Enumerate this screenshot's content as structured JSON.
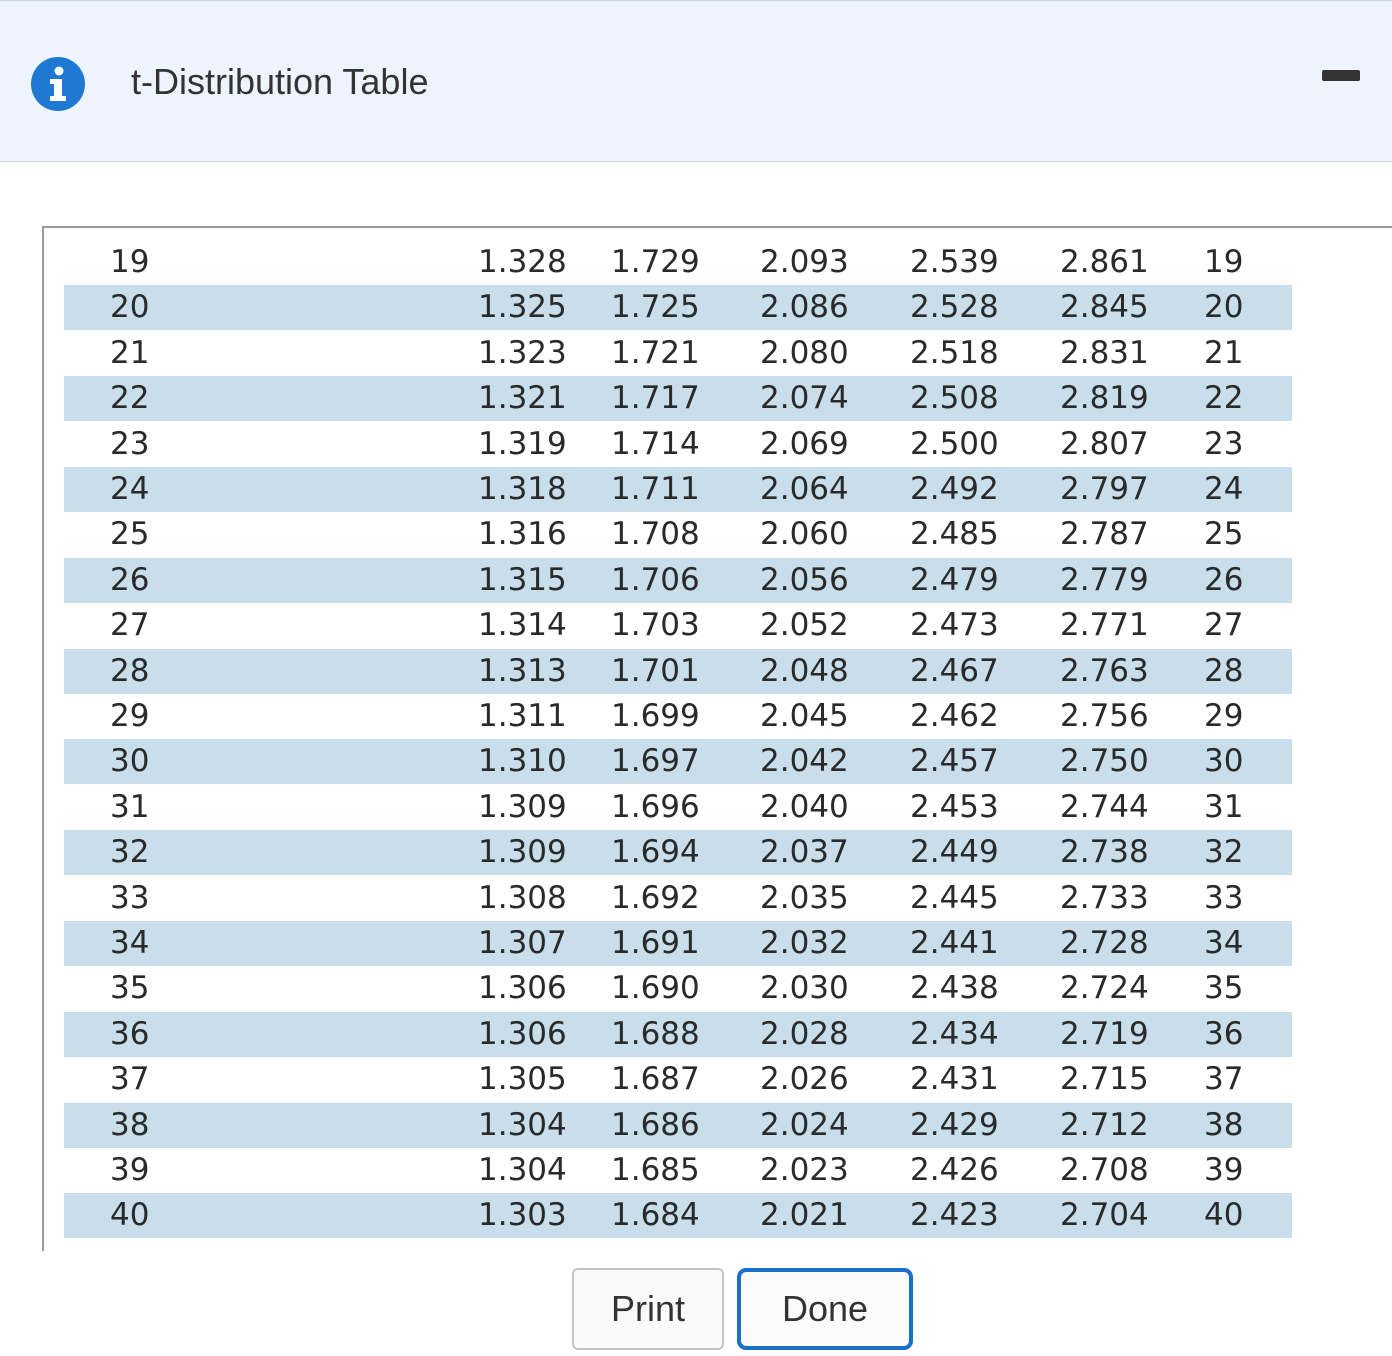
{
  "header": {
    "title": "t-Distribution Table",
    "icon": "info-icon",
    "accent_color": "#1f78d1"
  },
  "table": {
    "rows": [
      [
        "19",
        "1.328",
        "1.729",
        "2.093",
        "2.539",
        "2.861",
        "19"
      ],
      [
        "20",
        "1.325",
        "1.725",
        "2.086",
        "2.528",
        "2.845",
        "20"
      ],
      [
        "21",
        "1.323",
        "1.721",
        "2.080",
        "2.518",
        "2.831",
        "21"
      ],
      [
        "22",
        "1.321",
        "1.717",
        "2.074",
        "2.508",
        "2.819",
        "22"
      ],
      [
        "23",
        "1.319",
        "1.714",
        "2.069",
        "2.500",
        "2.807",
        "23"
      ],
      [
        "24",
        "1.318",
        "1.711",
        "2.064",
        "2.492",
        "2.797",
        "24"
      ],
      [
        "25",
        "1.316",
        "1.708",
        "2.060",
        "2.485",
        "2.787",
        "25"
      ],
      [
        "26",
        "1.315",
        "1.706",
        "2.056",
        "2.479",
        "2.779",
        "26"
      ],
      [
        "27",
        "1.314",
        "1.703",
        "2.052",
        "2.473",
        "2.771",
        "27"
      ],
      [
        "28",
        "1.313",
        "1.701",
        "2.048",
        "2.467",
        "2.763",
        "28"
      ],
      [
        "29",
        "1.311",
        "1.699",
        "2.045",
        "2.462",
        "2.756",
        "29"
      ],
      [
        "30",
        "1.310",
        "1.697",
        "2.042",
        "2.457",
        "2.750",
        "30"
      ],
      [
        "31",
        "1.309",
        "1.696",
        "2.040",
        "2.453",
        "2.744",
        "31"
      ],
      [
        "32",
        "1.309",
        "1.694",
        "2.037",
        "2.449",
        "2.738",
        "32"
      ],
      [
        "33",
        "1.308",
        "1.692",
        "2.035",
        "2.445",
        "2.733",
        "33"
      ],
      [
        "34",
        "1.307",
        "1.691",
        "2.032",
        "2.441",
        "2.728",
        "34"
      ],
      [
        "35",
        "1.306",
        "1.690",
        "2.030",
        "2.438",
        "2.724",
        "35"
      ],
      [
        "36",
        "1.306",
        "1.688",
        "2.028",
        "2.434",
        "2.719",
        "36"
      ],
      [
        "37",
        "1.305",
        "1.687",
        "2.026",
        "2.431",
        "2.715",
        "37"
      ],
      [
        "38",
        "1.304",
        "1.686",
        "2.024",
        "2.429",
        "2.712",
        "38"
      ],
      [
        "39",
        "1.304",
        "1.685",
        "2.023",
        "2.426",
        "2.708",
        "39"
      ],
      [
        "40",
        "1.303",
        "1.684",
        "2.021",
        "2.423",
        "2.704",
        "40"
      ]
    ]
  },
  "footer": {
    "print_label": "Print",
    "done_label": "Done"
  }
}
